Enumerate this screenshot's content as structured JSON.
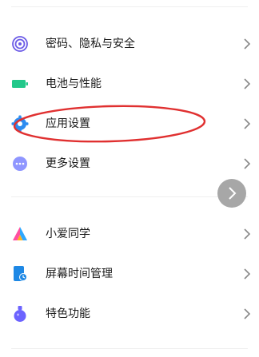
{
  "settings_group_1": [
    {
      "label": "密码、隐私与安全",
      "icon": "fingerprint-icon",
      "color": "#6c5ce7"
    },
    {
      "label": "电池与性能",
      "icon": "battery-icon",
      "color": "#22c88a"
    },
    {
      "label": "应用设置",
      "icon": "app-gear-icon",
      "color": "#2d8cf0"
    },
    {
      "label": "更多设置",
      "icon": "more-dots-icon",
      "color": "#8f96ff"
    }
  ],
  "settings_group_2": [
    {
      "label": "小爱同学",
      "icon": "xiaoai-icon"
    },
    {
      "label": "屏幕时间管理",
      "icon": "screen-time-icon",
      "color": "#1e88e5"
    },
    {
      "label": "特色功能",
      "icon": "feature-potion-icon",
      "color": "#6c63ff"
    }
  ],
  "colors": {
    "annotation": "#e03030",
    "chevron": "#888888",
    "floating_button": "#a7a7a7"
  }
}
